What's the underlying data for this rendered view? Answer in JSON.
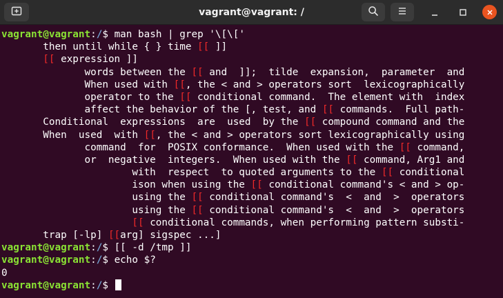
{
  "window": {
    "title": "vagrant@vagrant: /",
    "icons": {
      "new_tab": "new-tab-icon",
      "search": "search-icon",
      "menu": "hamburger-menu-icon",
      "minimize": "minimize-icon",
      "maximize": "maximize-icon",
      "close": "close-icon"
    },
    "colors": {
      "terminal_bg": "#300a24",
      "titlebar_bg": "#2c2c2c",
      "prompt_user": "#8ae234",
      "prompt_path": "#729fcf",
      "grep_match": "#ef2929",
      "close_button": "#e95420"
    }
  },
  "terminal": {
    "prompt": {
      "user_host": "vagrant@vagrant",
      "sep": ":",
      "path": "/",
      "symbol": "$ "
    },
    "lines": [
      {
        "kind": "prompt",
        "cmd": "man bash | grep '\\[\\['"
      },
      {
        "kind": "out",
        "segs": [
          {
            "t": "       then until while { } time "
          },
          {
            "t": "[[",
            "h": true
          },
          {
            "t": " ]]"
          }
        ]
      },
      {
        "kind": "out",
        "segs": [
          {
            "t": "       "
          },
          {
            "t": "[[",
            "h": true
          },
          {
            "t": " expression ]]"
          }
        ]
      },
      {
        "kind": "out",
        "segs": [
          {
            "t": "              words between the "
          },
          {
            "t": "[[",
            "h": true
          },
          {
            "t": " and  ]];  tilde  expansion,  parameter  and"
          }
        ]
      },
      {
        "kind": "out",
        "segs": [
          {
            "t": "              When used with "
          },
          {
            "t": "[[",
            "h": true
          },
          {
            "t": ", the < and > operators sort  lexicographically"
          }
        ]
      },
      {
        "kind": "out",
        "segs": [
          {
            "t": "              operator to the "
          },
          {
            "t": "[[",
            "h": true
          },
          {
            "t": " conditional command.  The element with  index"
          }
        ]
      },
      {
        "kind": "out",
        "segs": [
          {
            "t": "              affect the behavior of the [, test, and "
          },
          {
            "t": "[[",
            "h": true
          },
          {
            "t": " commands.  Full path-"
          }
        ]
      },
      {
        "kind": "out",
        "segs": [
          {
            "t": "       Conditional  expressions  are  used  by the "
          },
          {
            "t": "[[",
            "h": true
          },
          {
            "t": " compound command and the"
          }
        ]
      },
      {
        "kind": "out",
        "segs": [
          {
            "t": "       When  used  with "
          },
          {
            "t": "[[",
            "h": true
          },
          {
            "t": ", the < and > operators sort lexicographically using"
          }
        ]
      },
      {
        "kind": "out",
        "segs": [
          {
            "t": "              command  for  POSIX conformance.  When used with the "
          },
          {
            "t": "[[",
            "h": true
          },
          {
            "t": " command,"
          }
        ]
      },
      {
        "kind": "out",
        "segs": [
          {
            "t": "              or  negative  integers.  When used with the "
          },
          {
            "t": "[[",
            "h": true
          },
          {
            "t": " command, Arg1 and"
          }
        ]
      },
      {
        "kind": "out",
        "segs": [
          {
            "t": "                      with  respect  to quoted arguments to the "
          },
          {
            "t": "[[",
            "h": true
          },
          {
            "t": " conditional"
          }
        ]
      },
      {
        "kind": "out",
        "segs": [
          {
            "t": "                      ison when using the "
          },
          {
            "t": "[[",
            "h": true
          },
          {
            "t": " conditional command's < and > op-"
          }
        ]
      },
      {
        "kind": "out",
        "segs": [
          {
            "t": "                      using the "
          },
          {
            "t": "[[",
            "h": true
          },
          {
            "t": " conditional command's  <  and  >  operators"
          }
        ]
      },
      {
        "kind": "out",
        "segs": [
          {
            "t": "                      using the "
          },
          {
            "t": "[[",
            "h": true
          },
          {
            "t": " conditional command's  <  and  >  operators"
          }
        ]
      },
      {
        "kind": "out",
        "segs": [
          {
            "t": "                      "
          },
          {
            "t": "[[",
            "h": true
          },
          {
            "t": " conditional commands, when performing pattern substi-"
          }
        ]
      },
      {
        "kind": "out",
        "segs": [
          {
            "t": "       trap [-lp] "
          },
          {
            "t": "[[",
            "h": true
          },
          {
            "t": "arg] sigspec ...]"
          }
        ]
      },
      {
        "kind": "prompt",
        "cmd": "[[ -d /tmp ]]"
      },
      {
        "kind": "prompt",
        "cmd": "echo $?"
      },
      {
        "kind": "out",
        "segs": [
          {
            "t": "0"
          }
        ]
      },
      {
        "kind": "prompt",
        "cmd": "",
        "cursor": true
      }
    ]
  }
}
